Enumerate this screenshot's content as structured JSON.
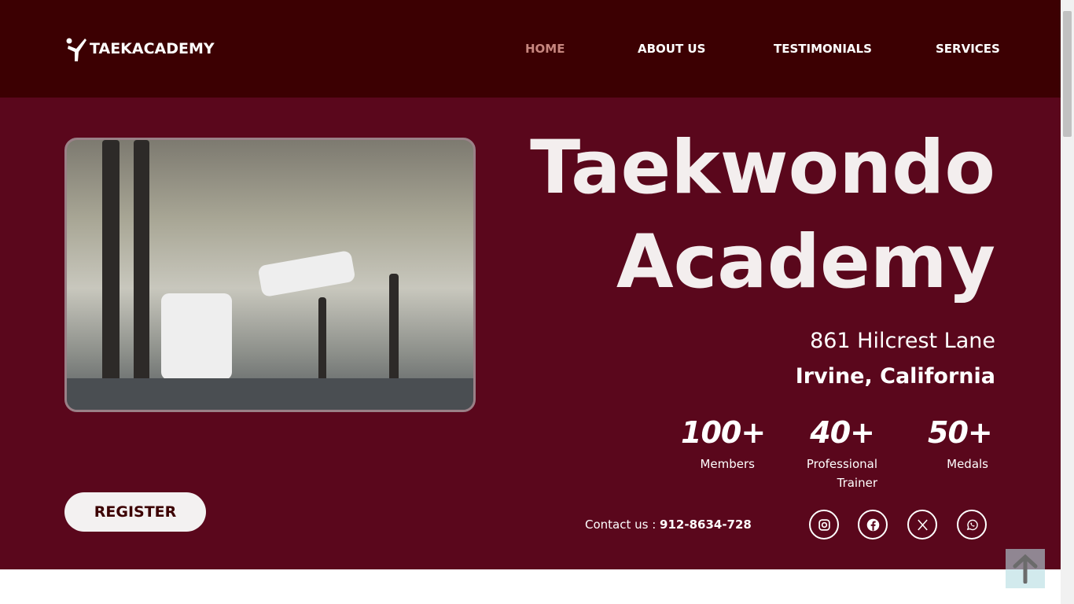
{
  "header": {
    "logo": "TAEKACADEMY",
    "nav": [
      "HOME",
      "ABOUT US",
      "TESTIMONIALS",
      "SERVICES"
    ]
  },
  "hero": {
    "title_line1": "Taekwondo",
    "title_line2": "Academy",
    "address_line1": "861 Hilcrest Lane",
    "address_line2": "Irvine, California",
    "stats": [
      {
        "value": "100+",
        "label": "Members"
      },
      {
        "value": "40+",
        "label": "Professional Trainer"
      },
      {
        "value": "50+",
        "label": "Medals"
      }
    ],
    "contact_label": "Contact us : ",
    "contact_phone": "912-8634-728",
    "register": "REGISTER",
    "social": [
      "instagram-icon",
      "facebook-icon",
      "x-icon",
      "whatsapp-icon"
    ]
  },
  "colors": {
    "header": "#3c0002",
    "hero": "#5a071c",
    "active_nav": "#c7867f"
  }
}
